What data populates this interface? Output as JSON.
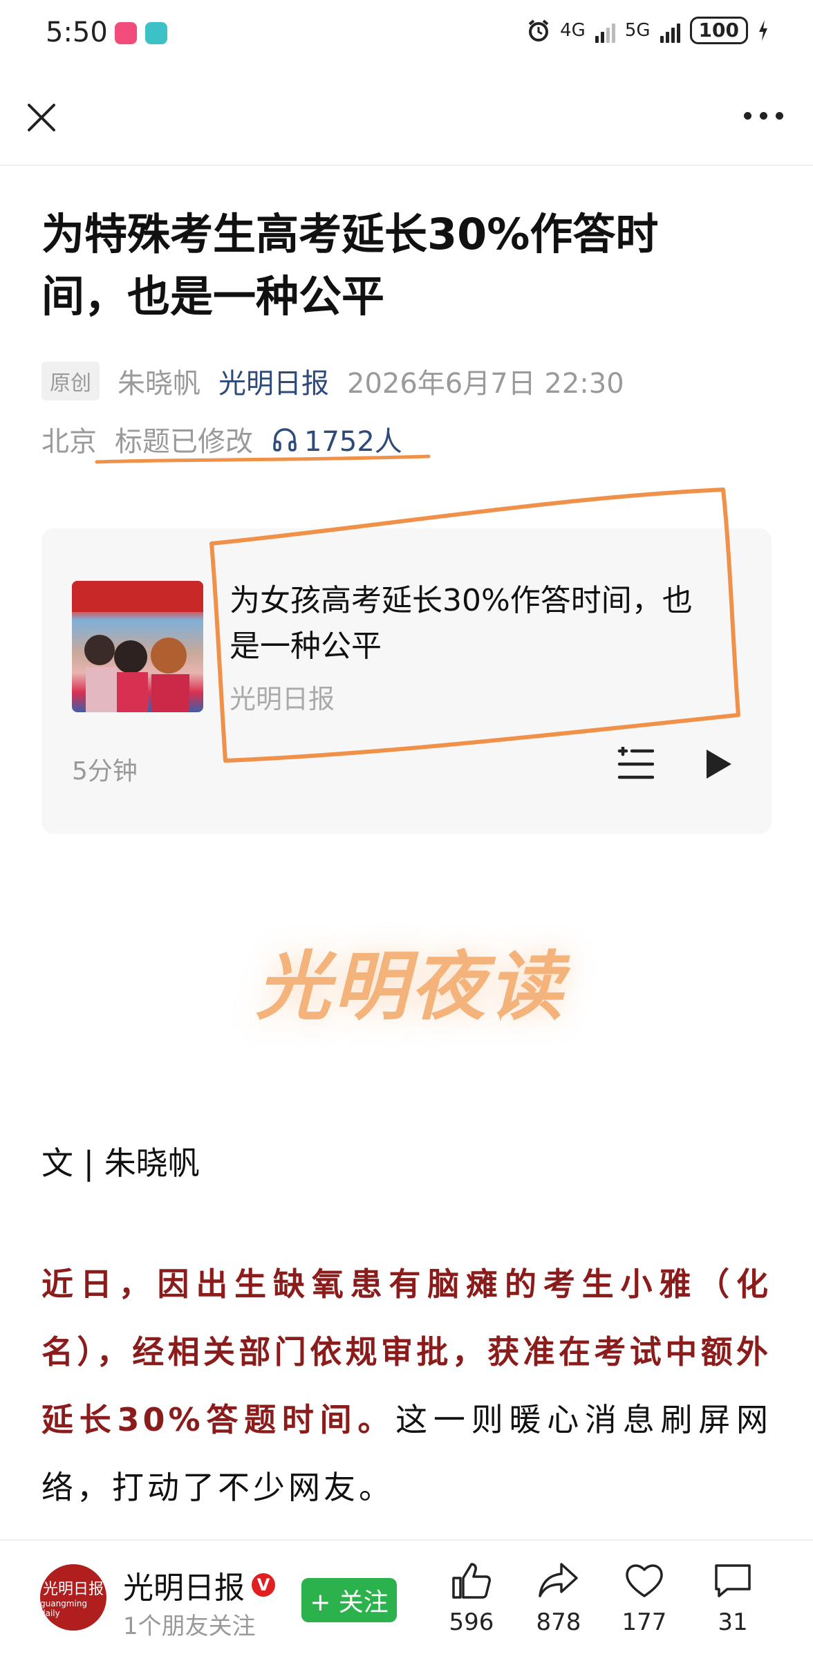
{
  "status_bar": {
    "time": "5:50",
    "network1": "4G",
    "network2": "5G",
    "battery": "100"
  },
  "header": {
    "close_icon": "close-icon",
    "more_icon": "more-icon"
  },
  "article": {
    "title": "为特殊考生高考延长30%作答时间，也是一种公平",
    "original_badge": "原创",
    "author": "朱晓帆",
    "source": "光明日报",
    "datetime": "2026年6月7日 22:30",
    "location": "北京",
    "edited_note": "标题已修改",
    "listeners": "1752人"
  },
  "audio_card": {
    "title": "为女孩高考延长30%作答时间，也是一种公平",
    "source": "光明日报",
    "duration": "5分钟"
  },
  "body": {
    "logo_text": "光明夜读",
    "byline": "文 | 朱晓帆",
    "highlight": "近日，因出生缺氧患有脑瘫的考生小雅（化名），经相关部门依规审批，获准在考试中额外延长30%答题时间。",
    "rest": "这一则暖心消息刷屏网络，打动了不少网友。"
  },
  "bottom_bar": {
    "avatar_text": "光明日报",
    "avatar_sub": "guangming daily",
    "publisher": "光明日报",
    "verified": "V",
    "followers_note": "1个朋友关注",
    "follow_label": "+ 关注",
    "likes": "596",
    "shares": "878",
    "favorites": "177",
    "comments": "31"
  },
  "colors": {
    "highlight_text": "#8b1c1c",
    "source_blue": "#2d4a7a",
    "follow_green": "#2bb24c",
    "annotation_orange": "#f0914a"
  }
}
